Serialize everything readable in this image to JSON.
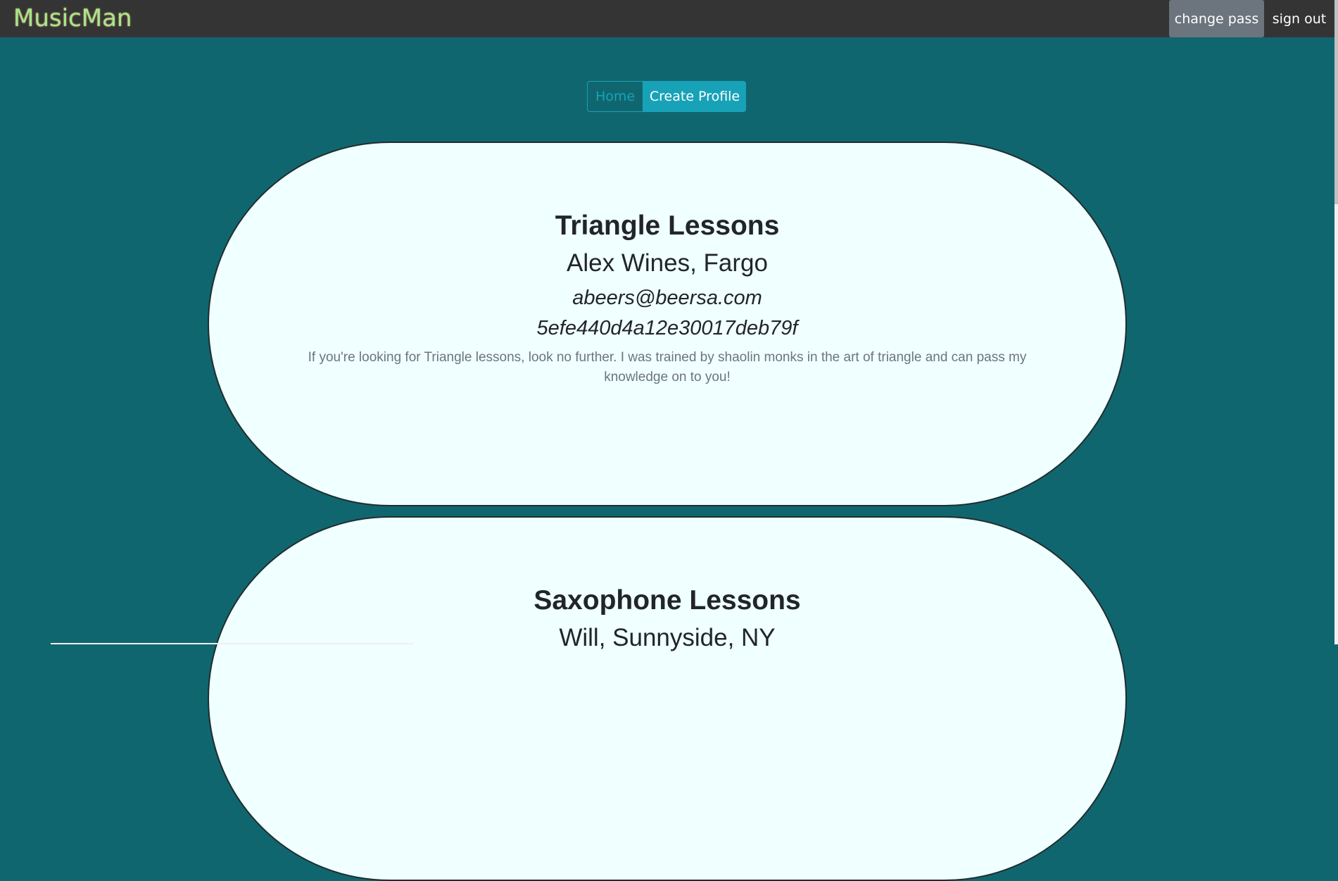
{
  "navbar": {
    "brand": "MusicMan",
    "change_pass_label": "change pass",
    "sign_out_label": "sign out"
  },
  "page_nav": {
    "home_label": "Home",
    "create_profile_label": "Create Profile"
  },
  "profiles": [
    {
      "title": "Triangle Lessons",
      "subtitle": "Alex Wines, Fargo",
      "email": "abeers@beersa.com",
      "id": "5efe440d4a12e30017deb79f",
      "description": "If you're looking for Triangle lessons, look no further. I was trained by shaolin monks in the art of triangle and can pass my knowledge on to you!"
    },
    {
      "title": "Saxophone Lessons",
      "subtitle": "Will, Sunnyside, NY"
    }
  ],
  "colors": {
    "page_background": "#10666f",
    "navbar_background": "#343434",
    "brand_color": "#a6e88c",
    "accent": "#17a2b8",
    "card_background": "#f0ffff"
  }
}
